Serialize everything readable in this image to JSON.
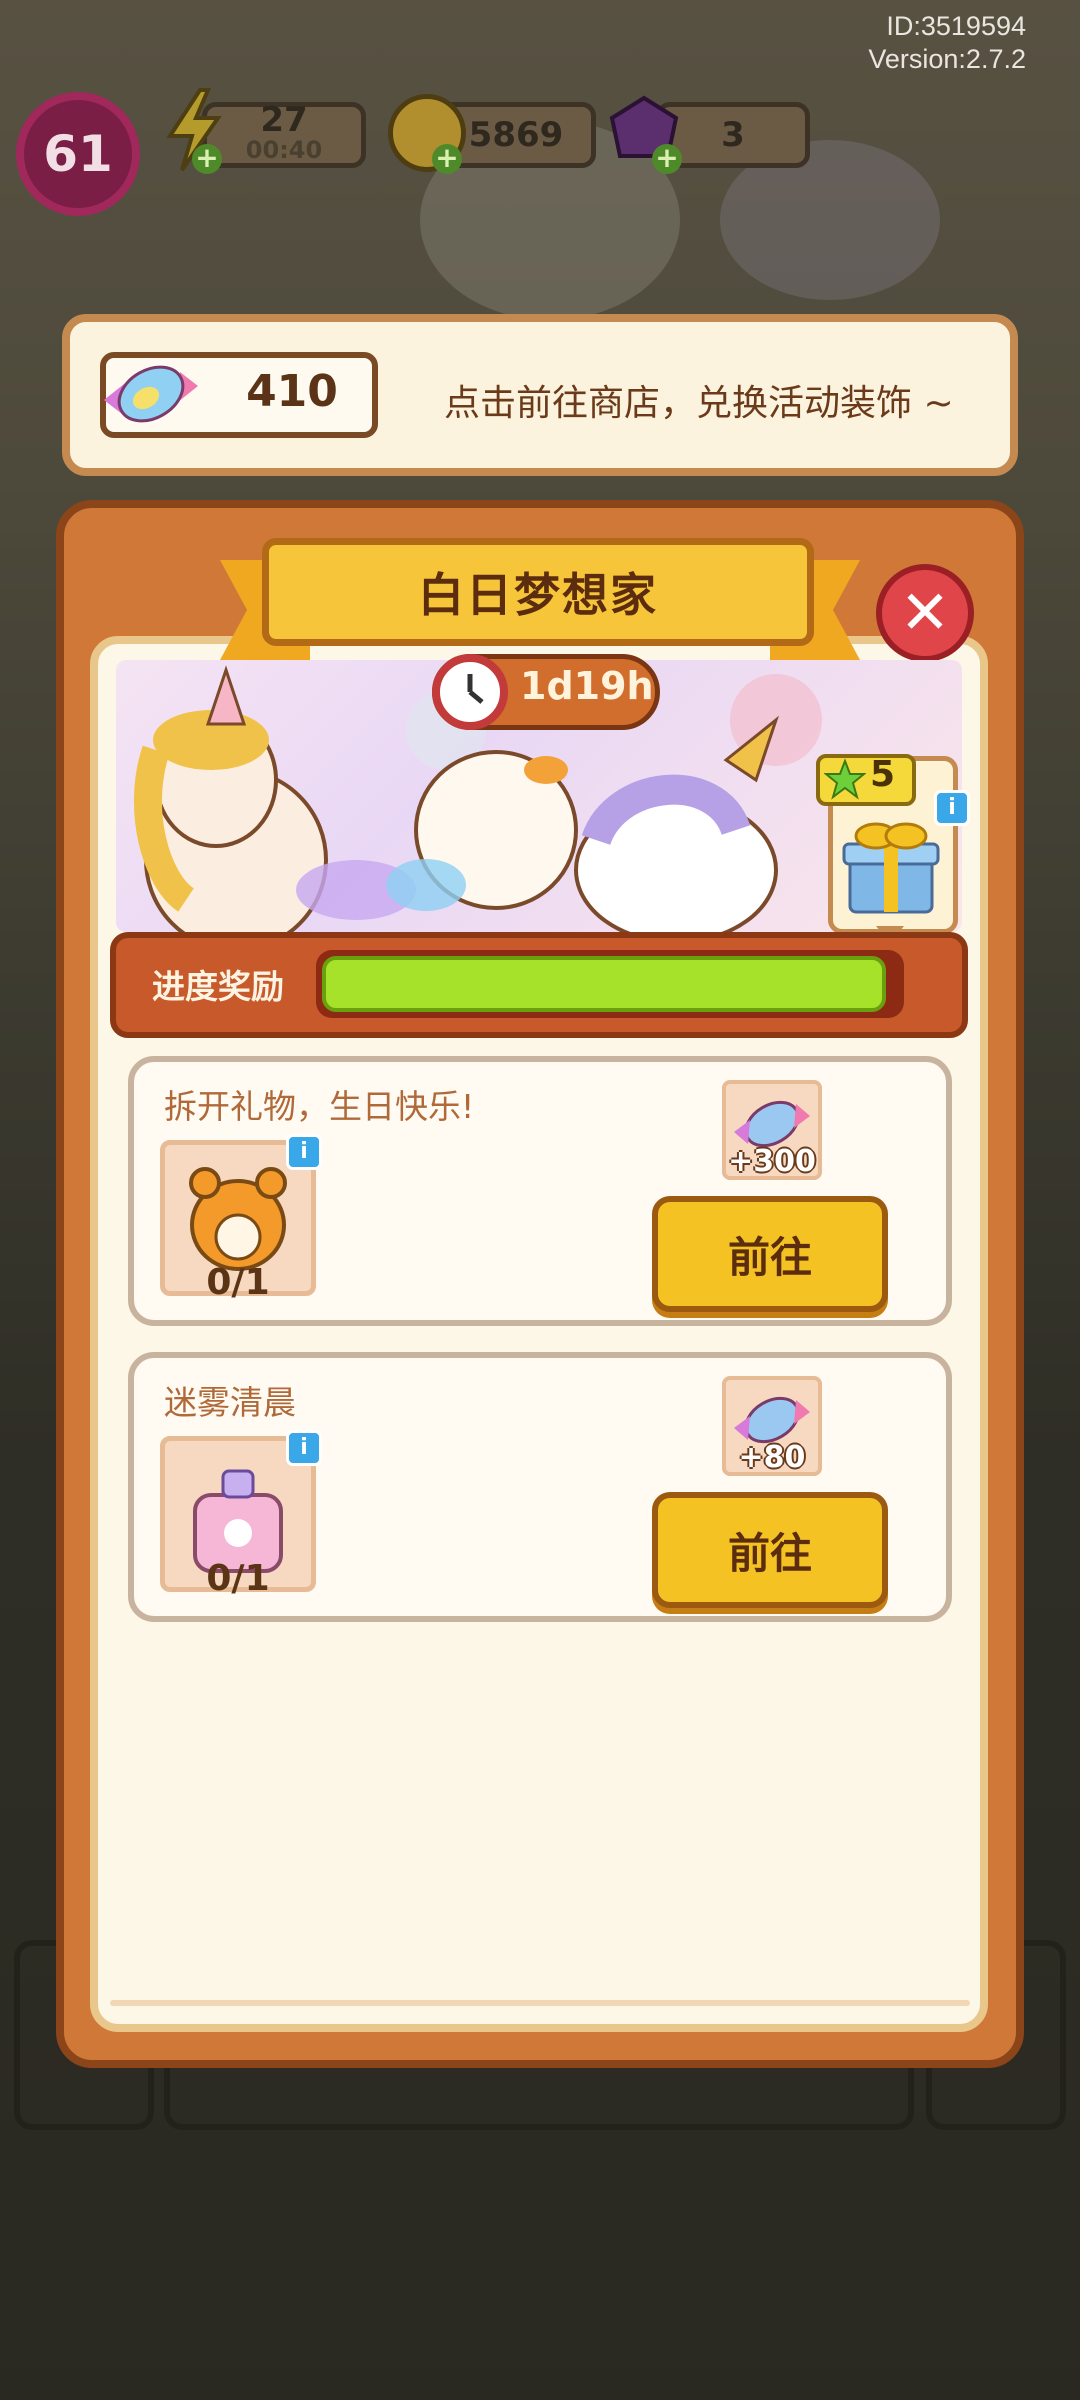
{
  "meta": {
    "id_text": "ID:3519594",
    "version_text": "Version:2.7.2"
  },
  "hud": {
    "level": "61",
    "energy": {
      "value": "27",
      "timer": "00:40",
      "icon": "lightning-icon"
    },
    "coins": {
      "value": "5869",
      "icon": "coin-icon"
    },
    "gems": {
      "value": "3",
      "icon": "gem-icon"
    }
  },
  "shop_banner": {
    "candy_count": "410",
    "hint": "点击前往商店，兑换活动装饰 ~",
    "icon": "candy-icon"
  },
  "event": {
    "title": "白日梦想家",
    "timer": "1d19h",
    "milestone_stars": "5",
    "progress_label": "进度奖励",
    "progress_fraction": 0.98
  },
  "tasks": [
    {
      "title": "拆开礼物，生日快乐!",
      "count": "0/1",
      "reward": "+300",
      "button": "前往",
      "item_icon": "hamster-cake-icon"
    },
    {
      "title": "迷雾清晨",
      "count": "0/1",
      "reward": "+80",
      "button": "前往",
      "item_icon": "perfume-bottle-icon"
    }
  ],
  "colors": {
    "accent": "#f5c224",
    "panel": "#d07838",
    "progress": "#a6e22a"
  }
}
